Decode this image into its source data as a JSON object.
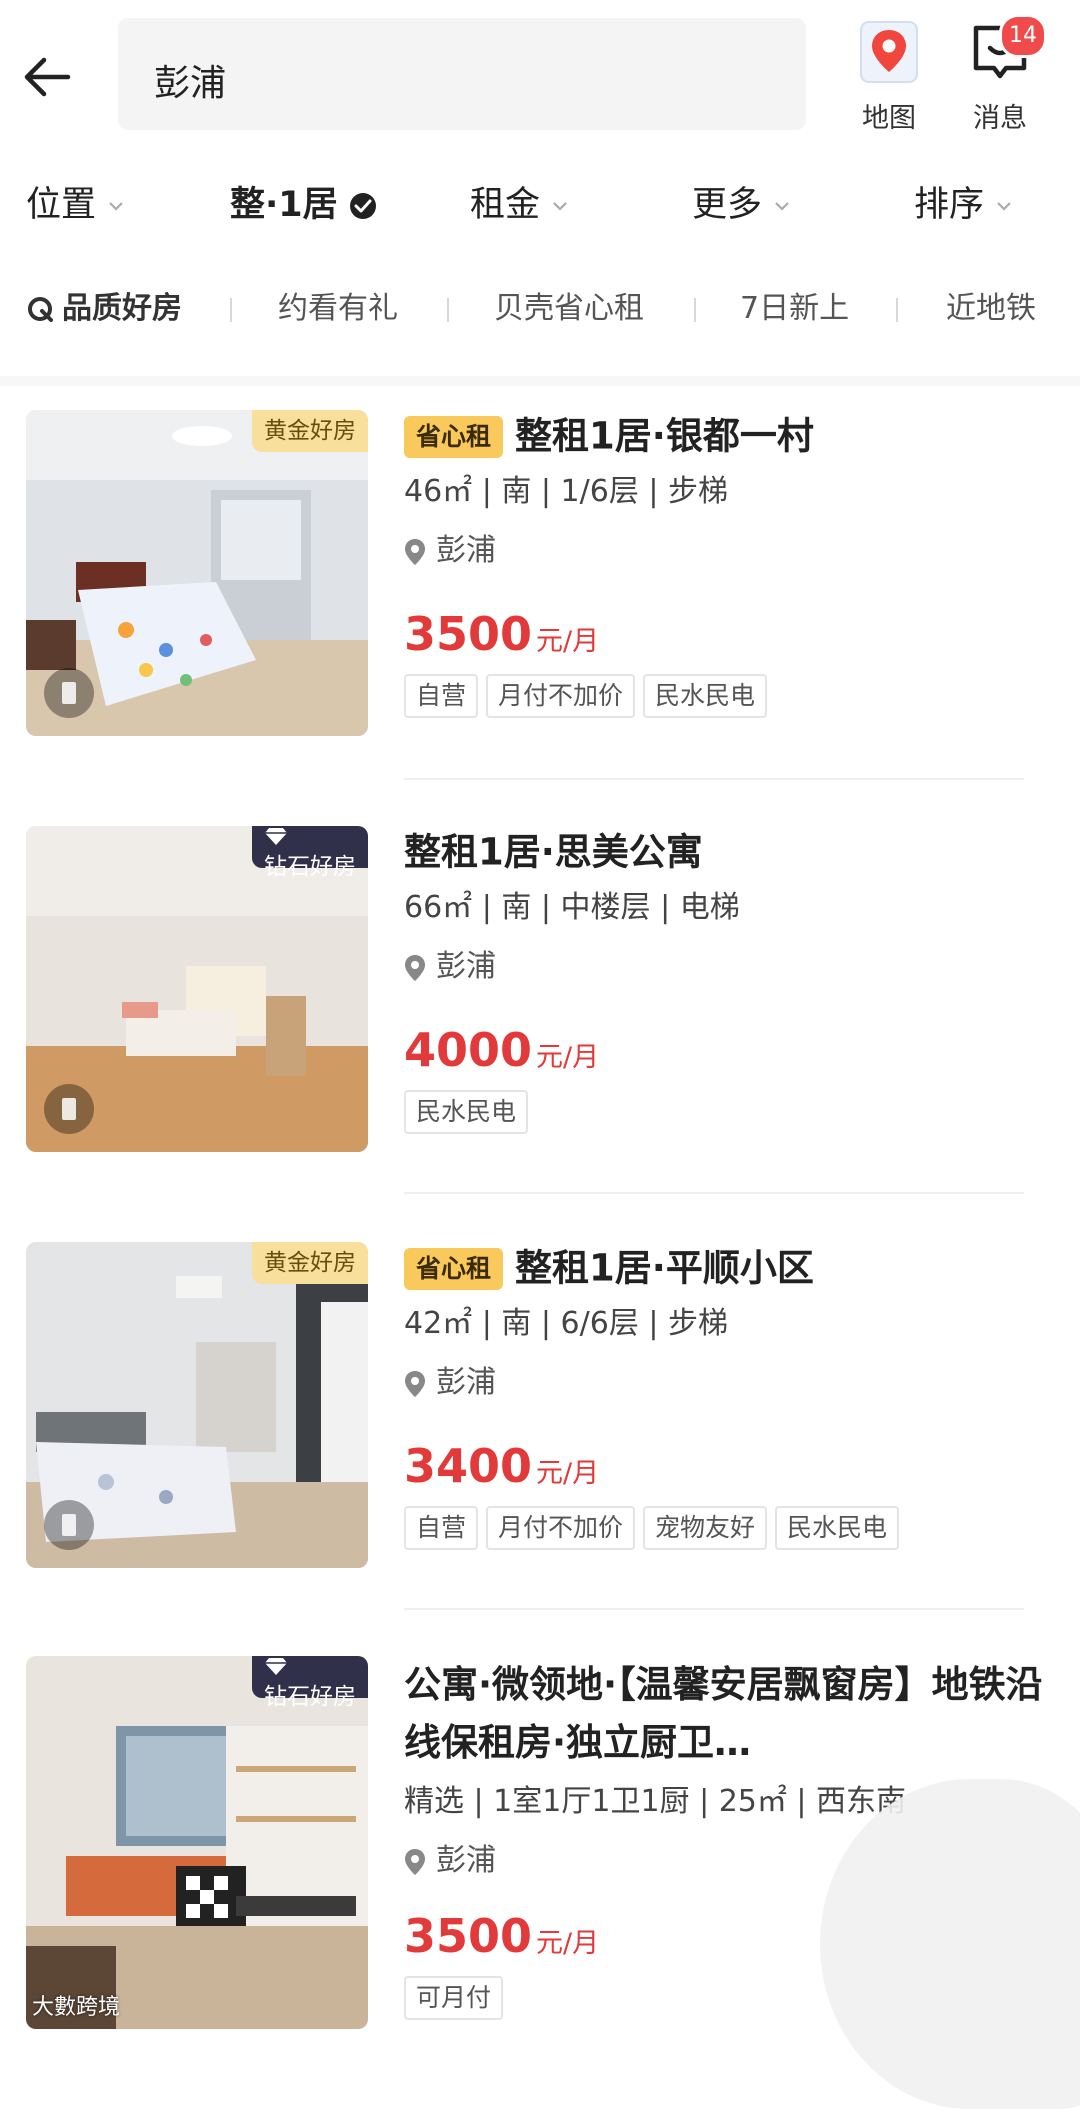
{
  "header": {
    "search_value": "彭浦",
    "map_label": "地图",
    "message_label": "消息",
    "message_badge": "14"
  },
  "filters": [
    {
      "label": "位置",
      "active": false
    },
    {
      "label": "整·1居",
      "active": true
    },
    {
      "label": "租金",
      "active": false
    },
    {
      "label": "更多",
      "active": false
    },
    {
      "label": "排序",
      "active": false
    }
  ],
  "tags": [
    "品质好房",
    "约看有礼",
    "贝壳省心租",
    "7日新上",
    "近地铁"
  ],
  "listings": [
    {
      "badge": "黄金好房",
      "brand": "省心租",
      "title": "整租1居·银都一村",
      "spec": "46㎡ | 南 | 1/6层 | 步梯",
      "location": "彭浦",
      "price": "3500",
      "unit": "元/月",
      "chips": [
        "自营",
        "月付不加价",
        "民水民电"
      ]
    },
    {
      "badge": "钻石好房",
      "brand": "",
      "title": "整租1居·思美公寓",
      "spec": "66㎡ | 南 | 中楼层 | 电梯",
      "location": "彭浦",
      "price": "4000",
      "unit": "元/月",
      "chips": [
        "民水民电"
      ]
    },
    {
      "badge": "黄金好房",
      "brand": "省心租",
      "title": "整租1居·平顺小区",
      "spec": "42㎡ | 南 | 6/6层 | 步梯",
      "location": "彭浦",
      "price": "3400",
      "unit": "元/月",
      "chips": [
        "自营",
        "月付不加价",
        "宠物友好",
        "民水民电"
      ]
    },
    {
      "badge": "钻石好房",
      "brand": "",
      "title": "公寓·微领地·【温馨安居飘窗房】地铁沿线保租房·独立厨卫…",
      "spec": "精选 | 1室1厅1卫1厨 | 25㎡ | 西东南",
      "location": "彭浦",
      "price": "3500",
      "unit": "元/月",
      "chips": [
        "可月付"
      ]
    }
  ],
  "watermark": "大數跨境",
  "colors": {
    "price": "#e23a3a",
    "gold_badge": "#f8df9b",
    "diamond_badge": "#30304a",
    "brand_chip": "#f9c95b",
    "badge_red": "#f04a4a"
  }
}
